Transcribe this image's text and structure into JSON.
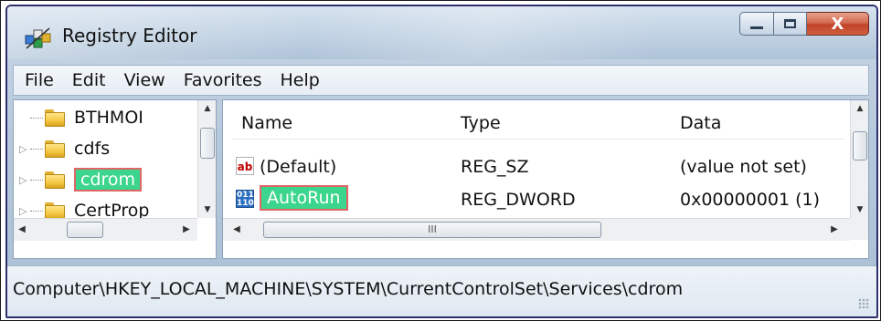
{
  "window": {
    "title": "Registry Editor",
    "close_glyph": "X"
  },
  "menu": [
    "File",
    "Edit",
    "View",
    "Favorites",
    "Help"
  ],
  "tree": {
    "items": [
      {
        "label": "BTHMOI",
        "icon": "folder-icon",
        "expander": "",
        "selected": false
      },
      {
        "label": "cdfs",
        "icon": "folder-icon",
        "expander": "▷",
        "selected": false
      },
      {
        "label": "cdrom",
        "icon": "folder-icon",
        "expander": "▷",
        "selected": true
      },
      {
        "label": "CertProp",
        "icon": "folder-icon",
        "expander": "▷",
        "selected": false
      }
    ]
  },
  "list": {
    "columns": [
      "Name",
      "Type",
      "Data"
    ],
    "rows": [
      {
        "name": "(Default)",
        "type": "REG_SZ",
        "data": "(value not set)",
        "icon": "string-value-icon",
        "icon_text": "ab",
        "selected": false
      },
      {
        "name": "AutoRun",
        "type": "REG_DWORD",
        "data": "0x00000001 (1)",
        "icon": "binary-value-icon",
        "icon_text": "011 110",
        "selected": true
      }
    ],
    "hscroll_grip": "III"
  },
  "status": {
    "path": "Computer\\HKEY_LOCAL_MACHINE\\SYSTEM\\CurrentControlSet\\Services\\cdrom"
  },
  "colors": {
    "selection_fill": "#3cd58d",
    "selection_outline": "#e06666",
    "title_bar": "#c2d3e4",
    "close_button": "#c0432a"
  }
}
